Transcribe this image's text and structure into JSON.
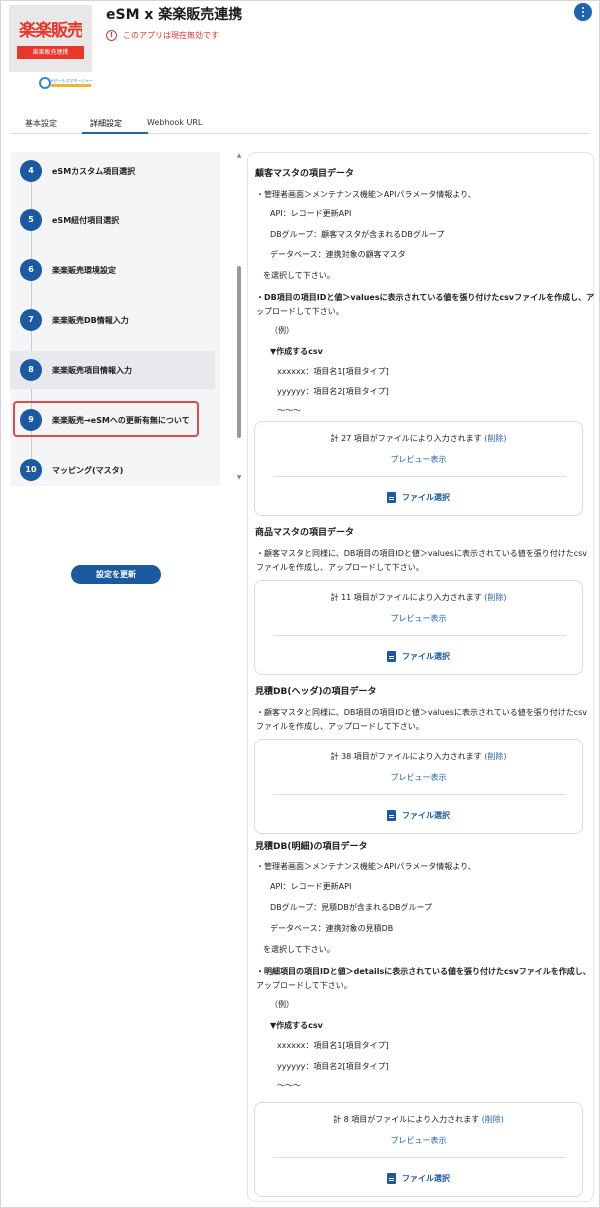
{
  "header": {
    "logo_text": "楽楽販売",
    "logo_sub": "楽楽販売連携",
    "esm_logo_text": "eセールスマネージャー",
    "title": "eSM x 楽楽販売連携",
    "warning_icon": "!",
    "warning": "このアプリは現在無効です",
    "menu_icon": "more-vertical-icon"
  },
  "tabs": [
    "基本設定",
    "詳細設定",
    "Webhook URL"
  ],
  "steps": [
    {
      "num": "4",
      "label": "eSMカスタム項目選択"
    },
    {
      "num": "5",
      "label": "eSM紐付項目選択"
    },
    {
      "num": "6",
      "label": "楽楽販売環境設定"
    },
    {
      "num": "7",
      "label": "楽楽販売DB情報入力"
    },
    {
      "num": "8",
      "label": "楽楽販売項目情報入力"
    },
    {
      "num": "9",
      "label": "楽楽販売→eSMへの更新有無について"
    },
    {
      "num": "10",
      "label": "マッピング(マスタ)"
    }
  ],
  "update_button": "設定を更新",
  "scroll": {
    "up": "▲",
    "down": "▼"
  },
  "sections": {
    "customer": {
      "title": "顧客マスタの項目データ",
      "intro": "・管理者画面＞メンテナンス機能＞APIパラメータ情報より、",
      "api": "API：レコード更新API",
      "db_group": "DBグループ：顧客マスタが含まれるDBグループ",
      "database": "データベース：連携対象の顧客マスタ",
      "select": "を選択して下さい。",
      "instr1": "・DB項目の項目IDと値＞valuesに表示されている値を張り付けたcsvファイルを作成し、ア",
      "instr2": "ップロードして下さい。",
      "example": "（例）",
      "csv_title": "▼作成するcsv",
      "row1": "xxxxxx：項目名1[項目タイプ]",
      "row2": "yyyyyy：項目名2[項目タイプ]",
      "ellipsis": "～～～",
      "card": {
        "count": "計 27 項目がファイルにより入力されます",
        "delete": "(削除)",
        "preview": "プレビュー表示",
        "file": "ファイル選択"
      }
    },
    "product": {
      "title": "商品マスタの項目データ",
      "line1": "・顧客マスタと同様に、DB項目の項目IDと値＞valuesに表示されている値を張り付けたcsv",
      "line2": "ファイルを作成し、アップロードして下さい。",
      "card": {
        "count": "計 11 項目がファイルにより入力されます",
        "delete": "(削除)",
        "preview": "プレビュー表示",
        "file": "ファイル選択"
      }
    },
    "estimate_header": {
      "title": "見積DB(ヘッダ)の項目データ",
      "line1": "・顧客マスタと同様に、DB項目の項目IDと値＞valuesに表示されている値を張り付けたcsv",
      "line2": "ファイルを作成し、アップロードして下さい。",
      "card": {
        "count": "計 38 項目がファイルにより入力されます",
        "delete": "(削除)",
        "preview": "プレビュー表示",
        "file": "ファイル選択"
      }
    },
    "estimate_detail": {
      "title": "見積DB(明細)の項目データ",
      "intro": "・管理者画面＞メンテナンス機能＞APIパラメータ情報より、",
      "api": "API：レコード更新API",
      "db_group": "DBグループ：見積DBが含まれるDBグループ",
      "database": "データベース：連携対象の見積DB",
      "select": "を選択して下さい。",
      "instr1": "・明細項目の項目IDと値＞detailsに表示されている値を張り付けたcsvファイルを作成し、",
      "instr2": "アップロードして下さい。",
      "example": "（例）",
      "csv_title": "▼作成するcsv",
      "row1": "xxxxxx：項目名1[項目タイプ]",
      "row2": "yyyyyy：項目名2[項目タイプ]",
      "ellipsis": "～～～",
      "card": {
        "count": "計 8 項目がファイルにより入力されます",
        "delete": "(削除)",
        "preview": "プレビュー表示",
        "file": "ファイル選択"
      }
    }
  }
}
